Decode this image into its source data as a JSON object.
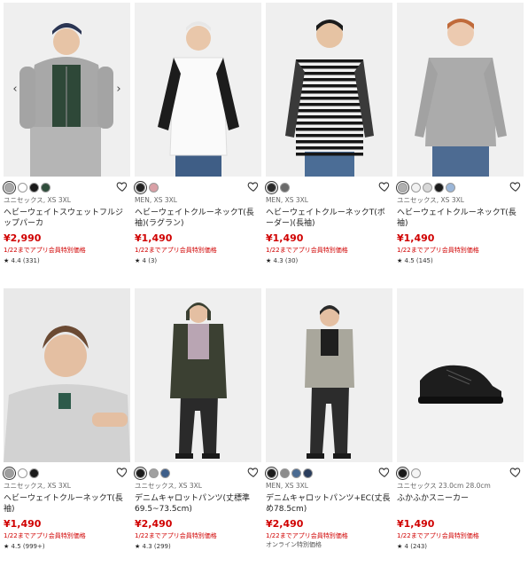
{
  "products": [
    {
      "meta": "ユニセックス, XS 3XL",
      "name": "ヘビーウェイトスウェットフルジップパーカ",
      "price": "¥2,990",
      "promo": "1/22までアプリ会員特別価格",
      "star": "★",
      "rating": "4.4",
      "count": "(331)",
      "arrows": true,
      "swatches": [
        "#a9a9a9",
        "#ffffff",
        "#1a1a1a",
        "#2f4d3b"
      ],
      "selected": 0,
      "online": ""
    },
    {
      "meta": "MEN, XS 3XL",
      "name": "ヘビーウェイトクルーネックT(長袖)(ラグラン)",
      "price": "¥1,490",
      "promo": "1/22までアプリ会員特別価格",
      "star": "★",
      "rating": "4",
      "count": "(3)",
      "arrows": false,
      "swatches": [
        "#222222",
        "#d9a0a6"
      ],
      "selected": 0,
      "online": ""
    },
    {
      "meta": "MEN, XS 3XL",
      "name": "ヘビーウェイトクルーネックT(ボーダー)(長袖)",
      "price": "¥1,490",
      "promo": "1/22までアプリ会員特別価格",
      "star": "★",
      "rating": "4.3",
      "count": "(30)",
      "arrows": false,
      "swatches": [
        "#2a2a2a",
        "#6b6b6b"
      ],
      "selected": 0,
      "online": ""
    },
    {
      "meta": "ユニセックス, XS 3XL",
      "name": "ヘビーウェイトクルーネックT(長袖)",
      "price": "¥1,490",
      "promo": "1/22までアプリ会員特別価格",
      "star": "★",
      "rating": "4.5",
      "count": "(145)",
      "arrows": false,
      "swatches": [
        "#b0b0b0",
        "#f2f2f2",
        "#d8d8d8",
        "#1b1b1b",
        "#9bb6d8"
      ],
      "selected": 0,
      "online": ""
    },
    {
      "meta": "ユニセックス, XS 3XL",
      "name": "ヘビーウェイトクルーネックT(長袖)",
      "price": "¥1,490",
      "promo": "1/22までアプリ会員特別価格",
      "star": "★",
      "rating": "4.5",
      "count": "(999+)",
      "arrows": false,
      "swatches": [
        "#9e9e9e",
        "#ffffff",
        "#1a1a1a"
      ],
      "selected": 0,
      "online": ""
    },
    {
      "meta": "ユニセックス, XS 3XL",
      "name": "デニムキャロットパンツ(丈標準69.5~73.5cm)",
      "price": "¥2,490",
      "promo": "1/22までアプリ会員特別価格",
      "star": "★",
      "rating": "4.3",
      "count": "(299)",
      "arrows": false,
      "swatches": [
        "#1c1c1c",
        "#a0a0a0",
        "#3e5f8a"
      ],
      "selected": 0,
      "online": ""
    },
    {
      "meta": "MEN, XS 3XL",
      "name": "デニムキャロットパンツ+EC(丈長め78.5cm)",
      "price": "¥2,490",
      "promo": "1/22までアプリ会員特別価格",
      "star": "",
      "rating": "",
      "count": "",
      "arrows": false,
      "swatches": [
        "#1c1c1c",
        "#8c8c8c",
        "#4a6b92",
        "#2a3d5c"
      ],
      "selected": 0,
      "online": "オンライン特別価格"
    },
    {
      "meta": "ユニセックス 23.0cm 28.0cm",
      "name": "ふかふかスニーカー",
      "price": "¥1,490",
      "promo": "1/22までアプリ会員特別価格",
      "star": "★",
      "rating": "4",
      "count": "(243)",
      "arrows": false,
      "swatches": [
        "#1a1a1a",
        "#f5f5f5"
      ],
      "selected": 0,
      "online": ""
    }
  ],
  "icons": {
    "heart": "heart-icon",
    "prev": "chevron-left-icon",
    "next": "chevron-right-icon",
    "star": "star-icon"
  },
  "colors": {
    "price": "#d00000",
    "promo": "#d00000",
    "text": "#222222"
  }
}
